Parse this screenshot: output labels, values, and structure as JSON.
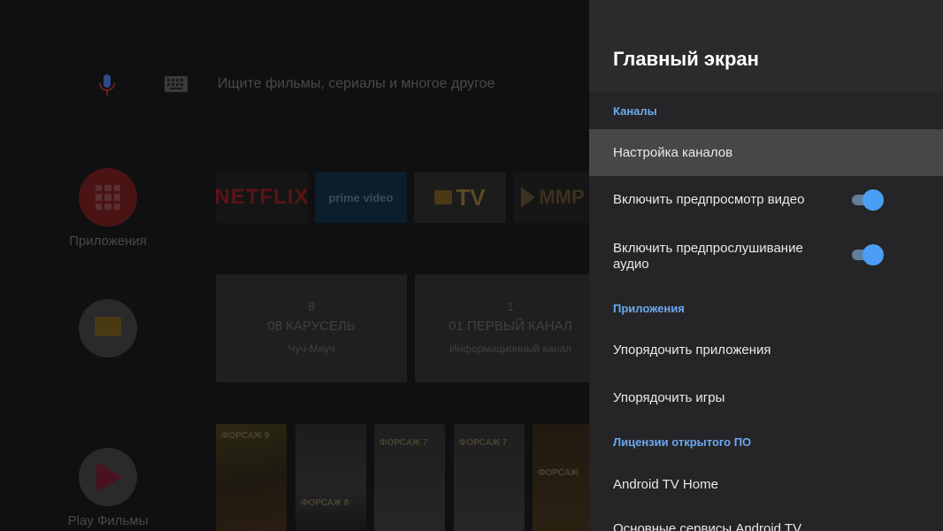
{
  "search": {
    "placeholder": "Ищите фильмы, сериалы и многое другое",
    "mic_icon": "mic-icon",
    "keyboard_icon": "keyboard-icon"
  },
  "sidebar": {
    "apps_label": "Приложения",
    "play_label": "Play Фильмы"
  },
  "app_row": {
    "netflix": "NETFLIX",
    "prime": "prime video",
    "tv": "TV",
    "mmp": "MMP"
  },
  "channels": [
    {
      "number": "8",
      "title": "08 КАРУСЕЛЬ",
      "desc": "Чуч-Мяуч"
    },
    {
      "number": "1",
      "title": "01 ПЕРВЫЙ КАНАЛ",
      "desc": "Информационный канал"
    }
  ],
  "posters": [
    "ФОРСАЖ 9",
    "ФОРСАЖ 8",
    "ФОРСАЖ 7",
    "ФОРСАЖ 7",
    "ФОРСАЖ"
  ],
  "panel": {
    "title": "Главный экран",
    "sections": {
      "channels": "Каналы",
      "apps": "Приложения",
      "licenses": "Лицензии открытого ПО"
    },
    "items": {
      "channel_setup": "Настройка каналов",
      "video_preview": "Включить предпросмотр видео",
      "audio_preview": "Включить предпрослушивание аудио",
      "sort_apps": "Упорядочить приложения",
      "sort_games": "Упорядочить игры",
      "atv_home": "Android TV Home",
      "atv_core": "Основные сервисы Android TV"
    },
    "toggles": {
      "video_preview_on": true,
      "audio_preview_on": true
    },
    "accent_color": "#4a9ff5"
  }
}
